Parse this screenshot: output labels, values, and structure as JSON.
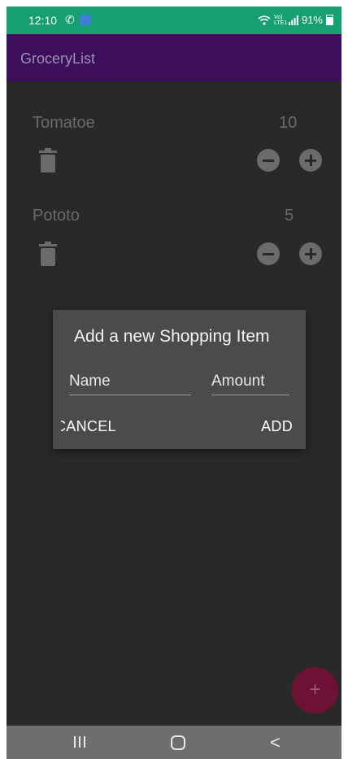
{
  "status_bar": {
    "time": "12:10",
    "call_icon": "phone-icon",
    "signal_text": "Vo) LTE1",
    "battery": "91%"
  },
  "app_bar": {
    "title": "GroceryList"
  },
  "items": [
    {
      "name": "Tomatoe",
      "quantity": "10"
    },
    {
      "name": "Pototo",
      "quantity": "5"
    }
  ],
  "dialog": {
    "title": "Add a new Shopping Item",
    "name_field": {
      "value": "Name"
    },
    "amount_field": {
      "value": "Amount"
    },
    "cancel_label": "CANCEL",
    "add_label": "ADD"
  },
  "fab": {
    "label": "+"
  },
  "nav": {
    "back": "<"
  },
  "colors": {
    "status_bar": "#16a071",
    "app_bar": "#3c0e5c",
    "background": "#292929",
    "dialog": "#4b4b4b",
    "fab": "#6d1235"
  }
}
